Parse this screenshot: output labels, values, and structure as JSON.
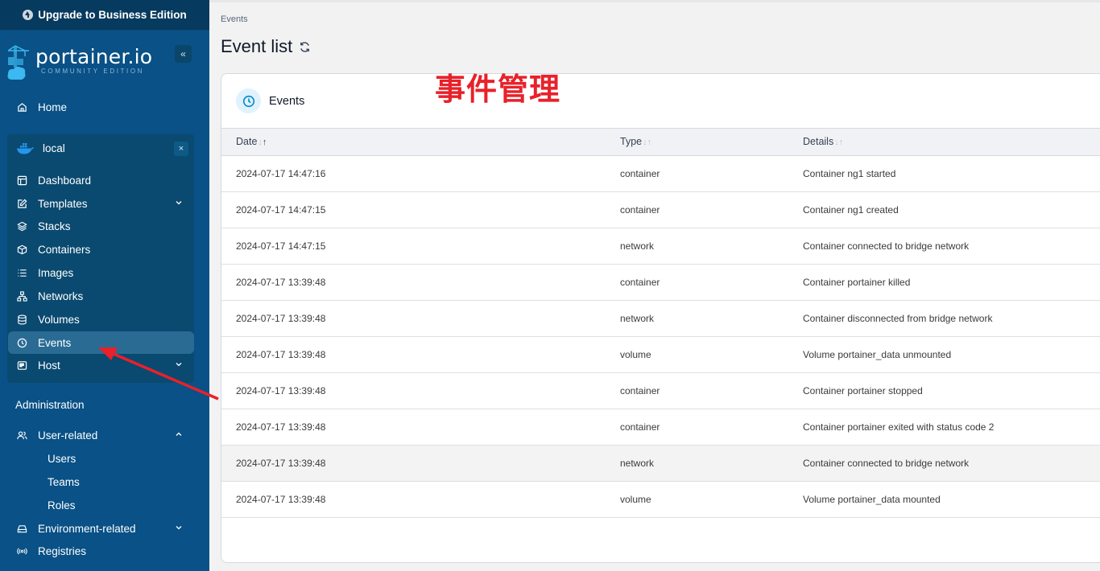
{
  "sidebar": {
    "upgrade_label": "Upgrade to Business Edition",
    "logo_text": "portainer.io",
    "logo_subtitle": "COMMUNITY EDITION",
    "collapse_icon": "chevrons-left-icon",
    "home_label": "Home",
    "environment": {
      "name": "local",
      "icon": "docker-icon",
      "close_label": "×",
      "items": [
        {
          "label": "Dashboard",
          "icon": "layout-icon"
        },
        {
          "label": "Templates",
          "icon": "edit-icon",
          "expandable": true
        },
        {
          "label": "Stacks",
          "icon": "layers-icon"
        },
        {
          "label": "Containers",
          "icon": "box-icon"
        },
        {
          "label": "Images",
          "icon": "list-icon"
        },
        {
          "label": "Networks",
          "icon": "network-icon"
        },
        {
          "label": "Volumes",
          "icon": "database-icon"
        },
        {
          "label": "Events",
          "icon": "clock-icon",
          "active": true
        },
        {
          "label": "Host",
          "icon": "host-icon",
          "expandable": true
        }
      ]
    },
    "administration": {
      "label": "Administration",
      "user_related": {
        "label": "User-related",
        "expanded": true,
        "children": [
          "Users",
          "Teams",
          "Roles"
        ]
      },
      "environment_related": {
        "label": "Environment-related"
      },
      "registries": {
        "label": "Registries"
      }
    }
  },
  "main": {
    "breadcrumb": "Events",
    "page_title": "Event list",
    "annotation": "事件管理",
    "annotation_color": "#e8212a",
    "card_title": "Events",
    "columns": [
      "Date",
      "Type",
      "Details"
    ],
    "sort": {
      "column": "Date",
      "direction": "asc"
    },
    "rows": [
      {
        "date": "2024-07-17 14:47:16",
        "type": "container",
        "details": "Container ng1 started"
      },
      {
        "date": "2024-07-17 14:47:15",
        "type": "container",
        "details": "Container ng1 created"
      },
      {
        "date": "2024-07-17 14:47:15",
        "type": "network",
        "details": "Container connected to bridge network"
      },
      {
        "date": "2024-07-17 13:39:48",
        "type": "container",
        "details": "Container portainer killed"
      },
      {
        "date": "2024-07-17 13:39:48",
        "type": "network",
        "details": "Container disconnected from bridge network"
      },
      {
        "date": "2024-07-17 13:39:48",
        "type": "volume",
        "details": "Volume portainer_data unmounted"
      },
      {
        "date": "2024-07-17 13:39:48",
        "type": "container",
        "details": "Container portainer stopped"
      },
      {
        "date": "2024-07-17 13:39:48",
        "type": "container",
        "details": "Container portainer exited with status code 2"
      },
      {
        "date": "2024-07-17 13:39:48",
        "type": "network",
        "details": "Container connected to bridge network"
      },
      {
        "date": "2024-07-17 13:39:48",
        "type": "volume",
        "details": "Volume portainer_data mounted"
      }
    ]
  },
  "colors": {
    "sidebar_bg": "#095186",
    "accent": "#0086c9",
    "annotation_arrow": "#e8212a"
  }
}
